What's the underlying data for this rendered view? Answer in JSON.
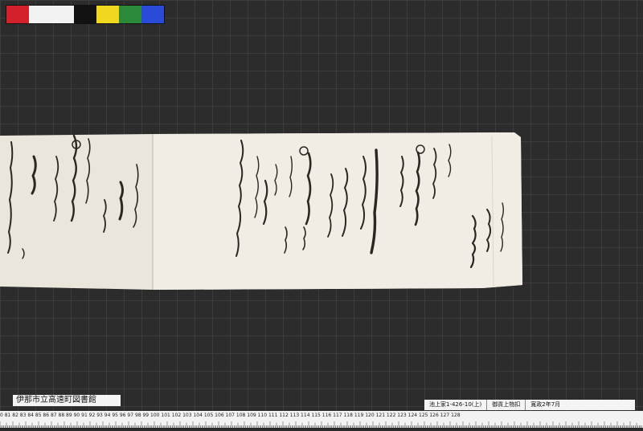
{
  "color_swatches": [
    "#d4202a",
    "#f2f2f2",
    "#121212",
    "#f0d820",
    "#2a8a3a",
    "#2a4ad8"
  ],
  "library_label": "伊那市立高遠町図書館",
  "catalog_label": {
    "code": "池上家1-426-10(上)",
    "title": "御貢上物扣",
    "date": "寛政2年7月"
  },
  "ruler_numbers": "0 81 82 83 84 85 86 87 88 89 90 91 92 93 94 95 96 97 98 99 100 101 102 103 104 105 106 107 108 109 110 111 112 113 114 115 116 117 118 119 120 121 122 123 124 125 126 127 128"
}
